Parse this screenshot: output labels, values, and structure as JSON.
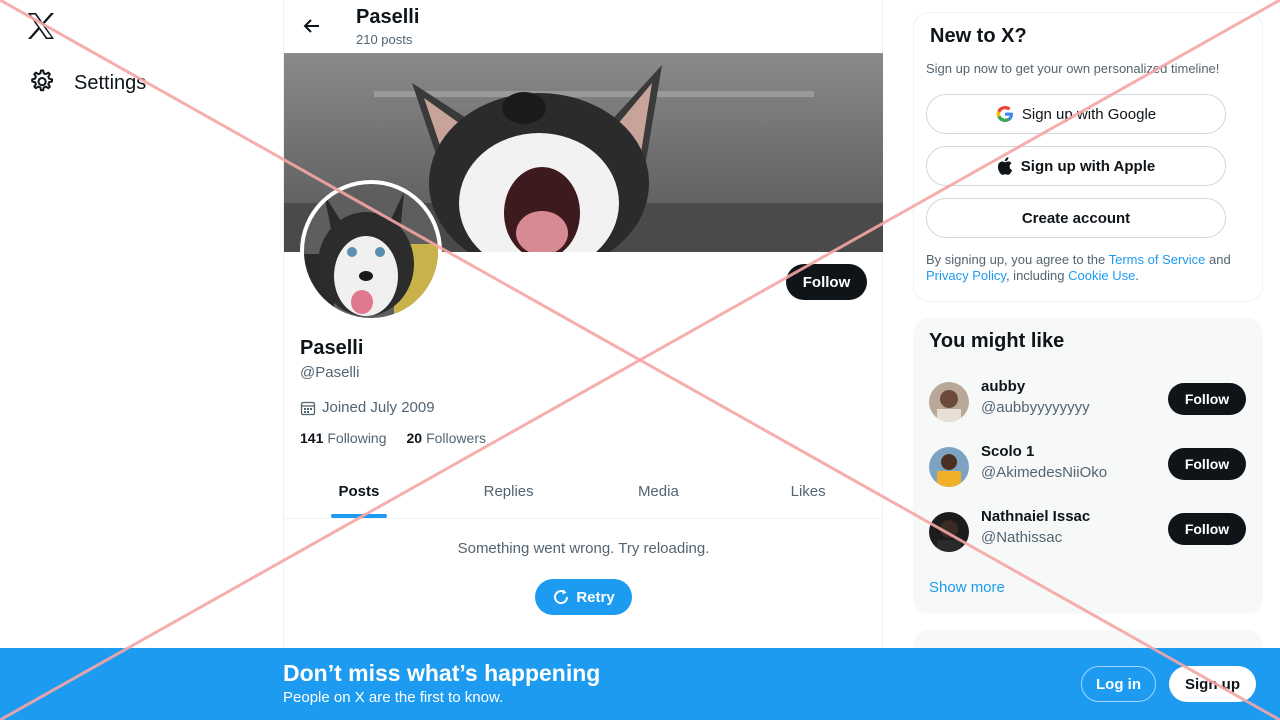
{
  "nav": {
    "settings_label": "Settings"
  },
  "header": {
    "title": "Paselli",
    "post_count": "210 posts"
  },
  "profile": {
    "follow_label": "Follow",
    "name": "Paselli",
    "handle": "@Paselli",
    "joined": "Joined July 2009",
    "following_count": "141",
    "following_label": "Following",
    "followers_count": "20",
    "followers_label": "Followers"
  },
  "tabs": [
    {
      "label": "Posts"
    },
    {
      "label": "Replies"
    },
    {
      "label": "Media"
    },
    {
      "label": "Likes"
    }
  ],
  "feed": {
    "error_text": "Something went wrong. Try reloading.",
    "retry_label": "Retry"
  },
  "signup": {
    "title": "New to X?",
    "subtitle": "Sign up now to get your own personalized timeline!",
    "google_label": "Sign up with Google",
    "apple_label": "Sign up with Apple",
    "create_label": "Create account",
    "terms_prefix": "By signing up, you agree to the ",
    "terms_link": "Terms of Service",
    "terms_and": " and ",
    "privacy_link": "Privacy Policy",
    "terms_including": ", including ",
    "cookie_link": "Cookie Use",
    "terms_end": "."
  },
  "who_to_follow": {
    "title": "You might like",
    "users": [
      {
        "name": "aubby",
        "handle": "@aubbyyyyyyyy",
        "follow_label": "Follow"
      },
      {
        "name": "Scolo 1",
        "handle": "@AkimedesNiiOko",
        "follow_label": "Follow"
      },
      {
        "name": "Nathnaiel Issac",
        "handle": "@Nathissac",
        "follow_label": "Follow"
      }
    ],
    "show_more": "Show more"
  },
  "bottom_bar": {
    "title": "Don’t miss what’s happening",
    "subtitle": "People on X are the first to know.",
    "login_label": "Log in",
    "signup_label": "Sign up"
  },
  "colors": {
    "accent": "#1d9bf0",
    "text_primary": "#0f1419",
    "text_secondary": "#536471",
    "overlay_x": "#f4a6a6"
  },
  "icons": [
    "x-logo-icon",
    "gear-icon",
    "back-arrow-icon",
    "calendar-icon",
    "retry-icon",
    "google-icon",
    "apple-icon"
  ]
}
